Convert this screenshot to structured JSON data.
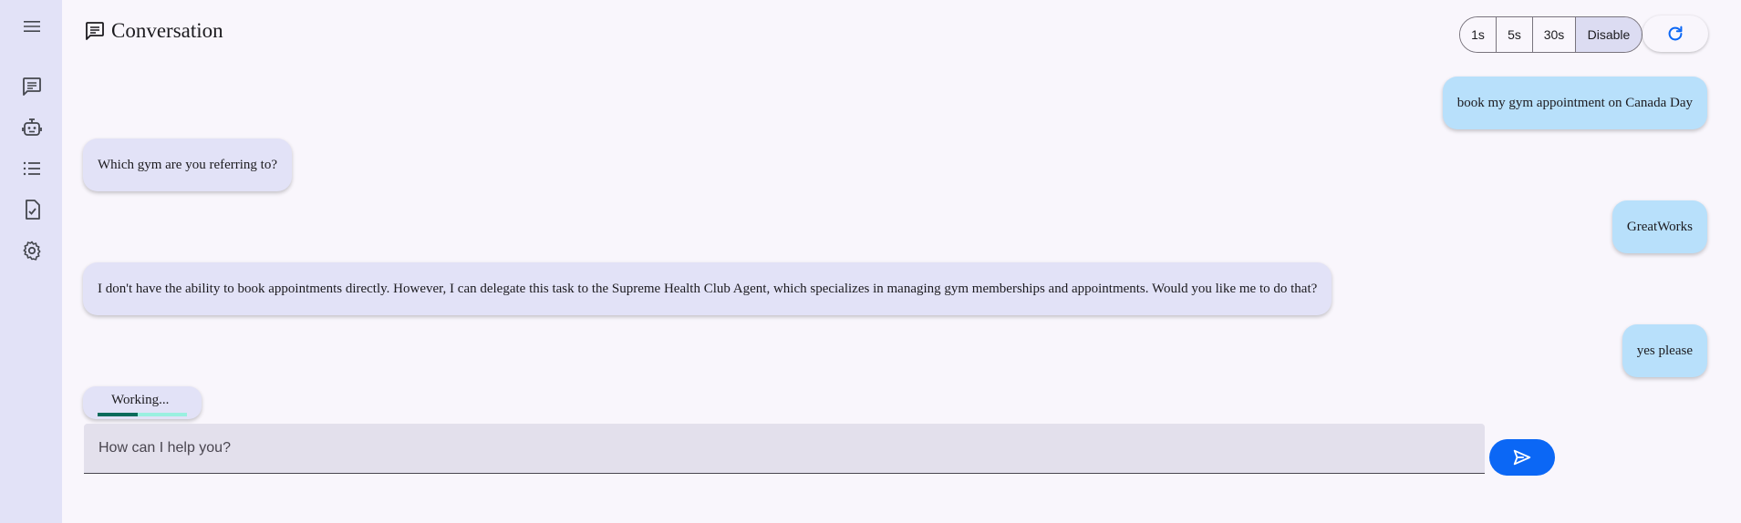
{
  "header": {
    "title": "Conversation",
    "icon": "chat-icon"
  },
  "sidebar": {
    "items": [
      {
        "icon": "menu-icon"
      },
      {
        "icon": "chat-icon"
      },
      {
        "icon": "robot-icon"
      },
      {
        "icon": "list-icon"
      },
      {
        "icon": "task-check-icon"
      },
      {
        "icon": "gear-icon"
      }
    ]
  },
  "refresh_controls": {
    "options": [
      "1s",
      "5s",
      "30s",
      "Disable"
    ],
    "selected": "Disable",
    "refresh_icon": "refresh-icon"
  },
  "messages": [
    {
      "role": "user",
      "text": "book my gym appointment on Canada Day"
    },
    {
      "role": "agent",
      "text": "Which gym are you referring to?"
    },
    {
      "role": "user",
      "text": "GreatWorks"
    },
    {
      "role": "agent",
      "text": "I don't have the ability to book appointments directly. However, I can delegate this task to the Supreme Health Club Agent, which specializes in managing gym memberships and appointments. Would you like me to do that?"
    },
    {
      "role": "user",
      "text": "yes please"
    }
  ],
  "status": {
    "label": "Working...",
    "progress": 0.45
  },
  "input": {
    "placeholder": "How can I help you?",
    "value": ""
  },
  "send": {
    "icon": "send-icon"
  },
  "colors": {
    "sidebar_bg": "#e2e2f7",
    "user_bubble": "#b8e0fb",
    "agent_bubble": "#e2e2f7",
    "accent": "#0b67f5",
    "progress_fill": "#0a6b5b",
    "progress_track": "#9af0e0"
  }
}
